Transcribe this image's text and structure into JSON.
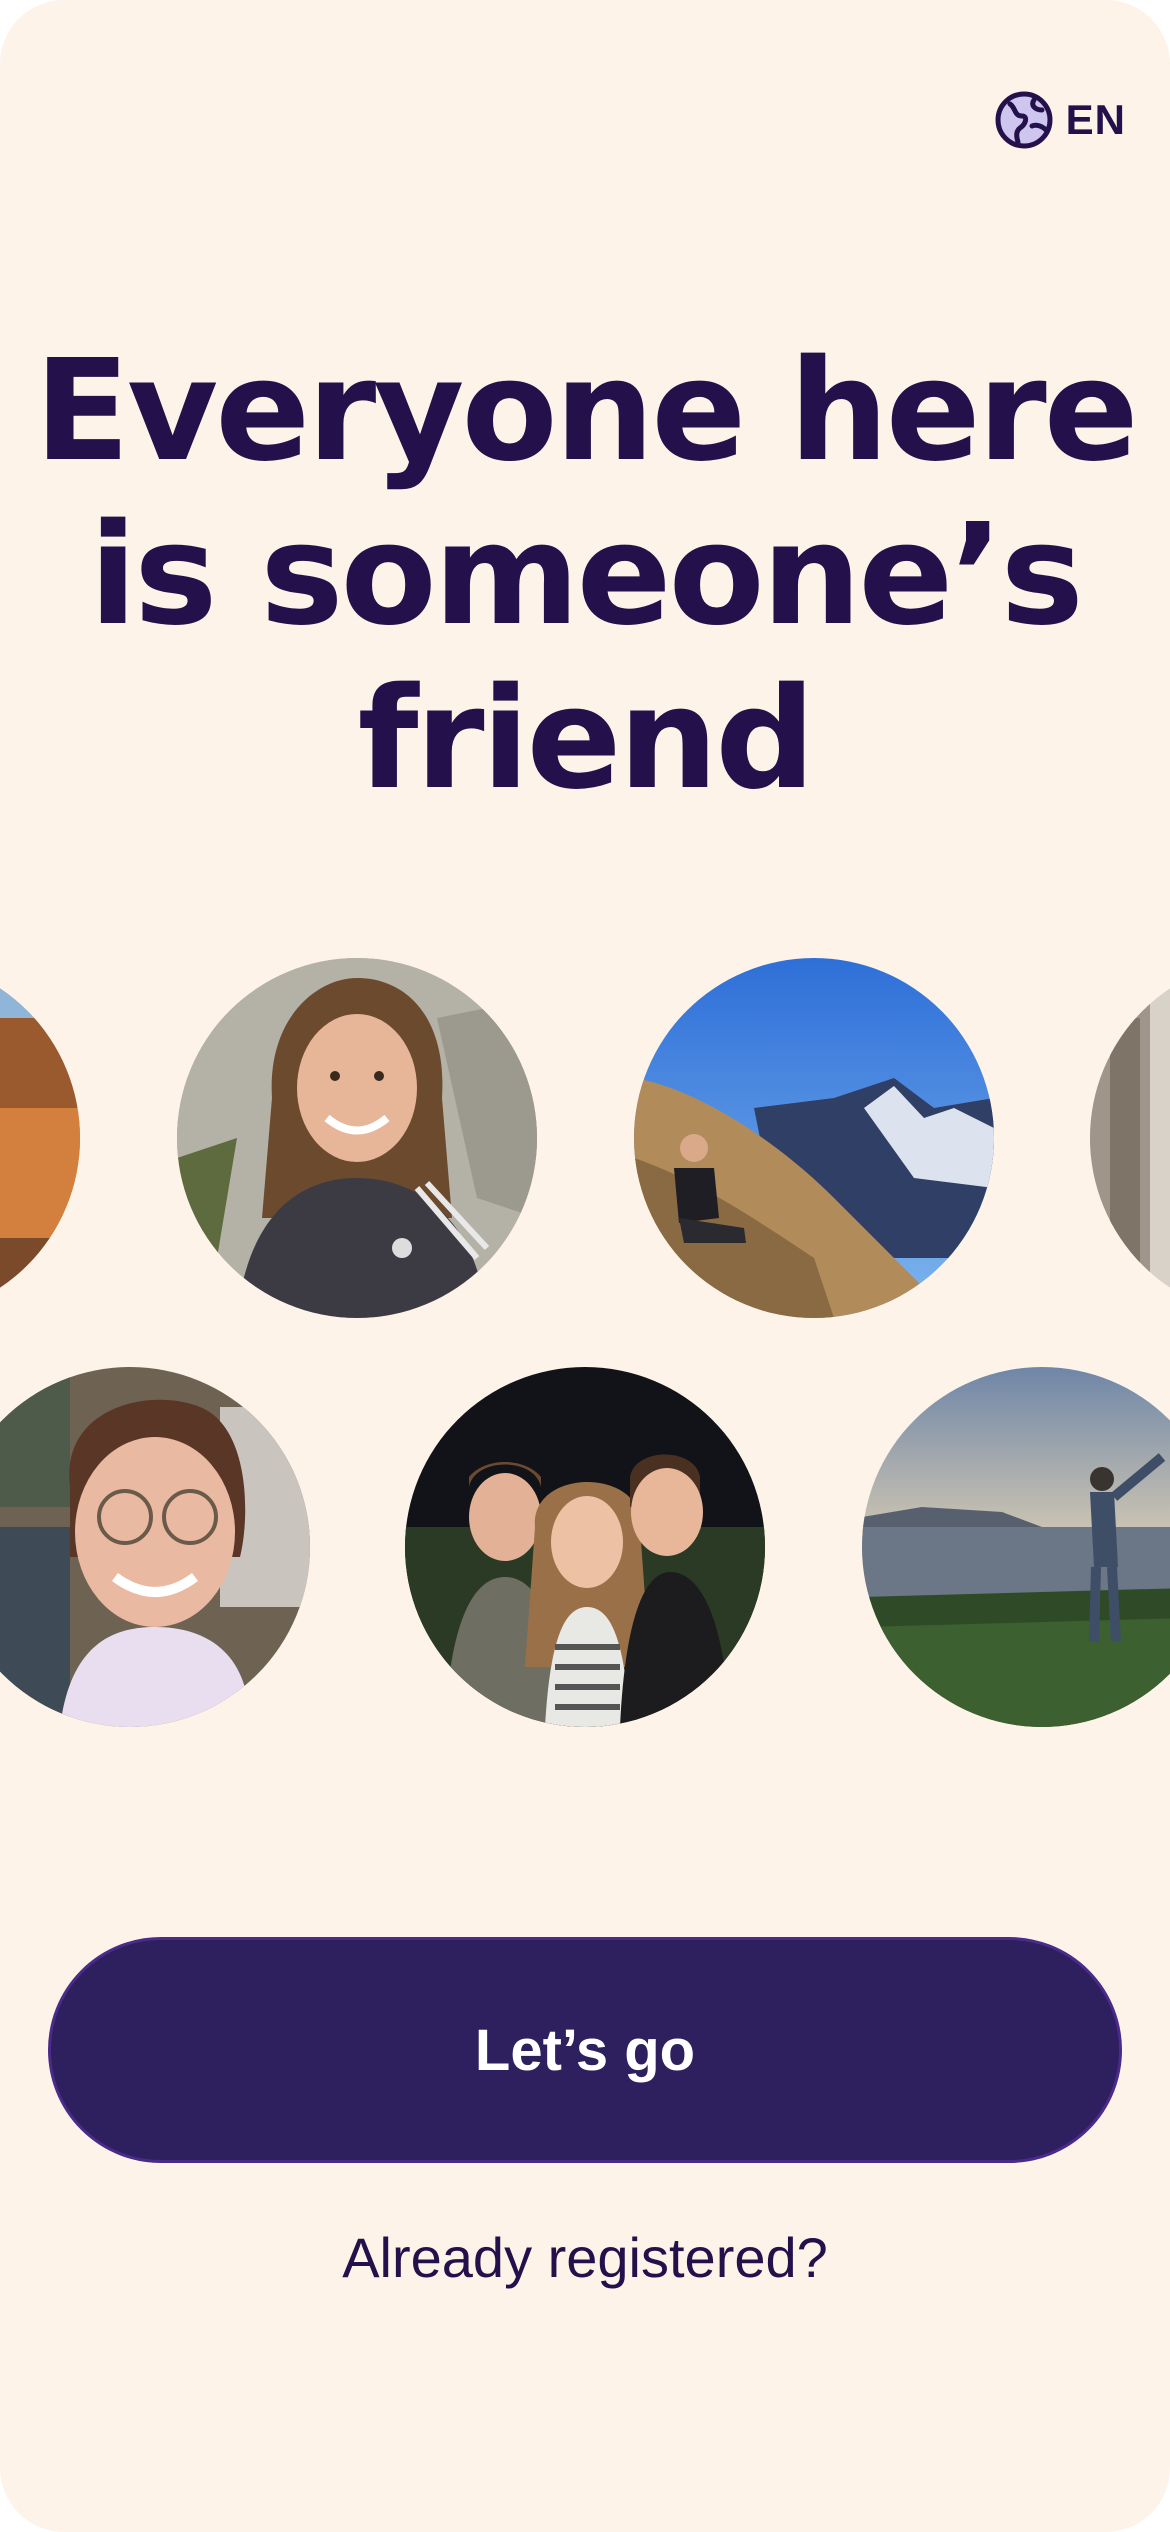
{
  "language_selector": {
    "code": "EN",
    "icon": "globe-icon"
  },
  "headline": {
    "line1": "Everyone here",
    "line2": "is someone’s",
    "line3": "friend"
  },
  "photos": [
    {
      "subject": "partial-photo-left-top"
    },
    {
      "subject": "smiling-man-long-hair"
    },
    {
      "subject": "person-on-mountain"
    },
    {
      "subject": "partial-photo-right-top"
    },
    {
      "subject": "woman-with-glasses"
    },
    {
      "subject": "three-friends"
    },
    {
      "subject": "person-at-seaside"
    }
  ],
  "cta": {
    "label": "Let’s go"
  },
  "secondary_link": {
    "label": "Already registered?"
  },
  "colors": {
    "background": "#FDF3E8",
    "primary": "#2E1F5E",
    "text": "#24114B"
  }
}
